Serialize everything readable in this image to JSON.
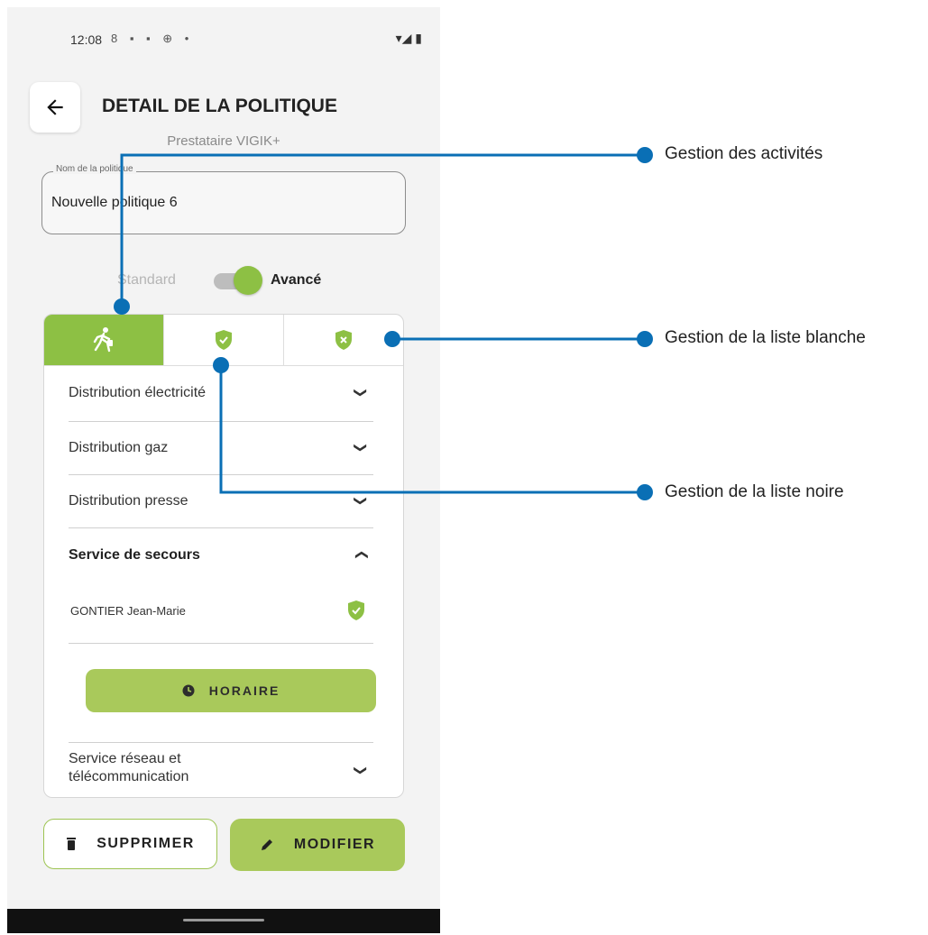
{
  "status_bar": {
    "time": "12:08",
    "icons": "8 ▪ ▪ ⊕ •",
    "right_icons": "▾◢ ▮"
  },
  "header": {
    "title": "DETAIL DE LA POLITIQUE",
    "subtitle": "Prestataire VIGIK+"
  },
  "name_field": {
    "label": "Nom de la politique",
    "value": "Nouvelle politique 6"
  },
  "mode_toggle": {
    "left_label": "Standard",
    "right_label": "Avancé",
    "selected": "Avancé"
  },
  "tabs": [
    {
      "icon": "person-walking-icon",
      "active": true
    },
    {
      "icon": "shield-check-icon",
      "active": false
    },
    {
      "icon": "shield-x-icon",
      "active": false
    }
  ],
  "activities": [
    {
      "label": "Distribution électricité",
      "expanded": false
    },
    {
      "label": "Distribution gaz",
      "expanded": false
    },
    {
      "label": "Distribution presse",
      "expanded": false
    },
    {
      "label": "Service de secours",
      "expanded": true,
      "sub_items": [
        {
          "label": "GONTIER Jean-Marie",
          "icon": "shield-check-icon"
        }
      ],
      "action": "HORAIRE"
    },
    {
      "label": "Service réseau et\ntélécommunication",
      "expanded": false
    }
  ],
  "buttons": {
    "delete": "SUPPRIMER",
    "modify": "MODIFIER"
  },
  "annotations": [
    {
      "label": "Gestion des activités"
    },
    {
      "label": "Gestion de la liste blanche"
    },
    {
      "label": "Gestion de la liste noire"
    }
  ],
  "colors": {
    "accent": "#8dc044",
    "button": "#a9c95b",
    "callout": "#0a6fb5"
  }
}
